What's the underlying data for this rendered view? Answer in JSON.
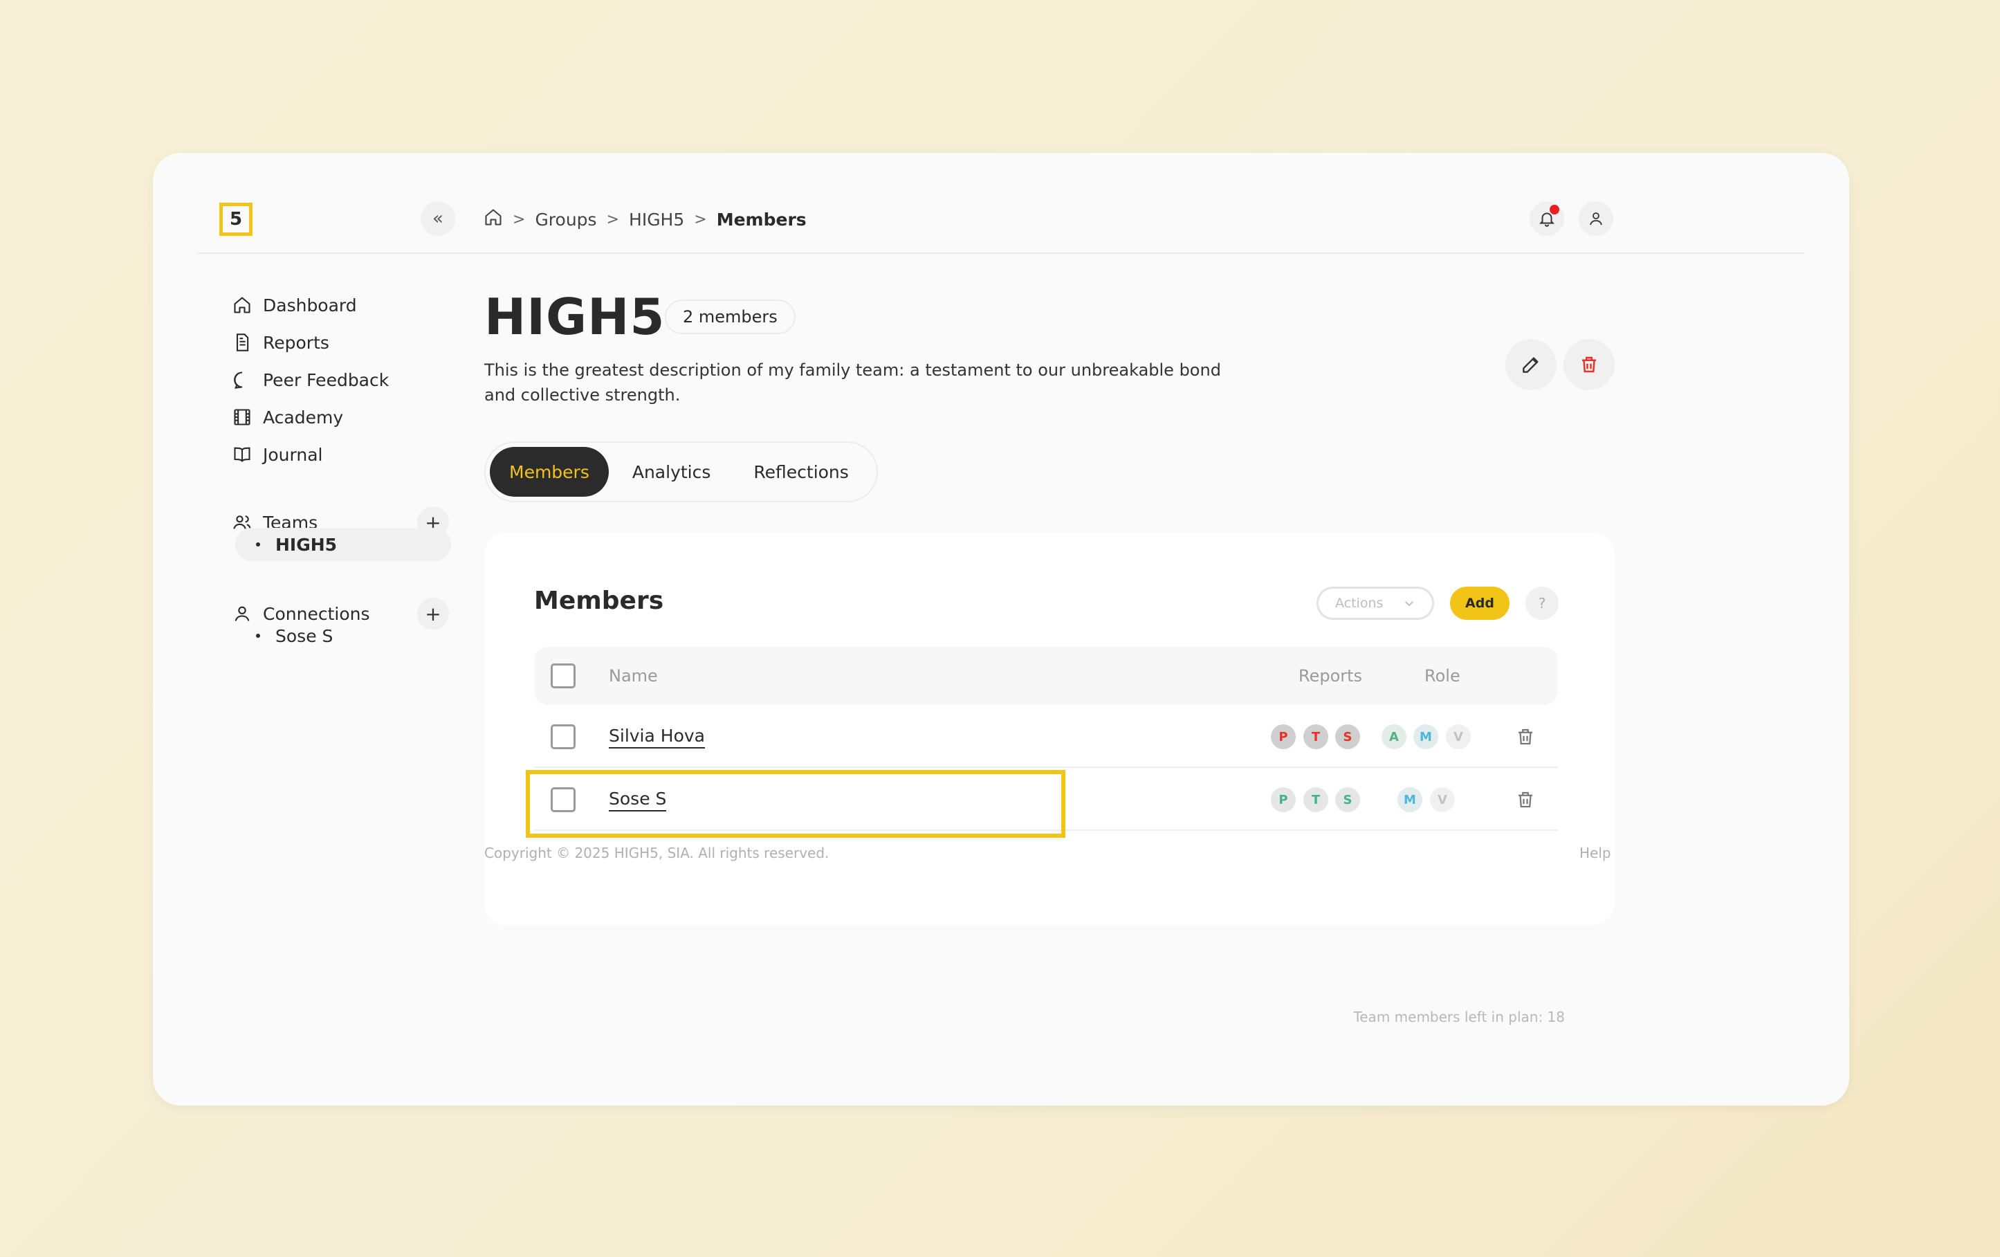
{
  "logo": {
    "text": "5"
  },
  "collapse": {
    "label": "«"
  },
  "breadcrumb": {
    "items": [
      "Groups",
      "HIGH5"
    ],
    "current": "Members",
    "separator": ">"
  },
  "sidebar": {
    "nav": [
      {
        "label": "Dashboard",
        "icon": "home-icon"
      },
      {
        "label": "Reports",
        "icon": "document-icon"
      },
      {
        "label": "Peer Feedback",
        "icon": "chat-icon"
      },
      {
        "label": "Academy",
        "icon": "film-icon"
      },
      {
        "label": "Journal",
        "icon": "book-icon"
      }
    ],
    "teams": {
      "label": "Teams",
      "items": [
        "HIGH5"
      ]
    },
    "connections": {
      "label": "Connections",
      "items": [
        "Sose S"
      ]
    }
  },
  "group": {
    "title": "HIGH5",
    "member_count": "2 members",
    "description": "This is the greatest description of my family team: a testament to our unbreakable bond and collective strength."
  },
  "tabs": [
    "Members",
    "Analytics",
    "Reflections"
  ],
  "members_card": {
    "title": "Members",
    "actions_label": "Actions",
    "add_label": "Add",
    "help_label": "?",
    "columns": {
      "name": "Name",
      "reports": "Reports",
      "role": "Role"
    },
    "rows": [
      {
        "name": "Silvia Hova",
        "reports": [
          "P",
          "T",
          "S"
        ],
        "roles": [
          "A",
          "M",
          "V"
        ]
      },
      {
        "name": "Sose S",
        "reports": [
          "P",
          "T",
          "S"
        ],
        "roles": [
          "M",
          "V"
        ]
      }
    ],
    "plan_left": "Team members left in plan: 18"
  },
  "footer": {
    "copyright": "Copyright © 2025 HIGH5, SIA. All rights reserved.",
    "help": "Help"
  },
  "colors": {
    "accent": "#f2c418",
    "dark": "#2b2b2b",
    "danger": "#e8312a",
    "notification": "#e82020"
  }
}
